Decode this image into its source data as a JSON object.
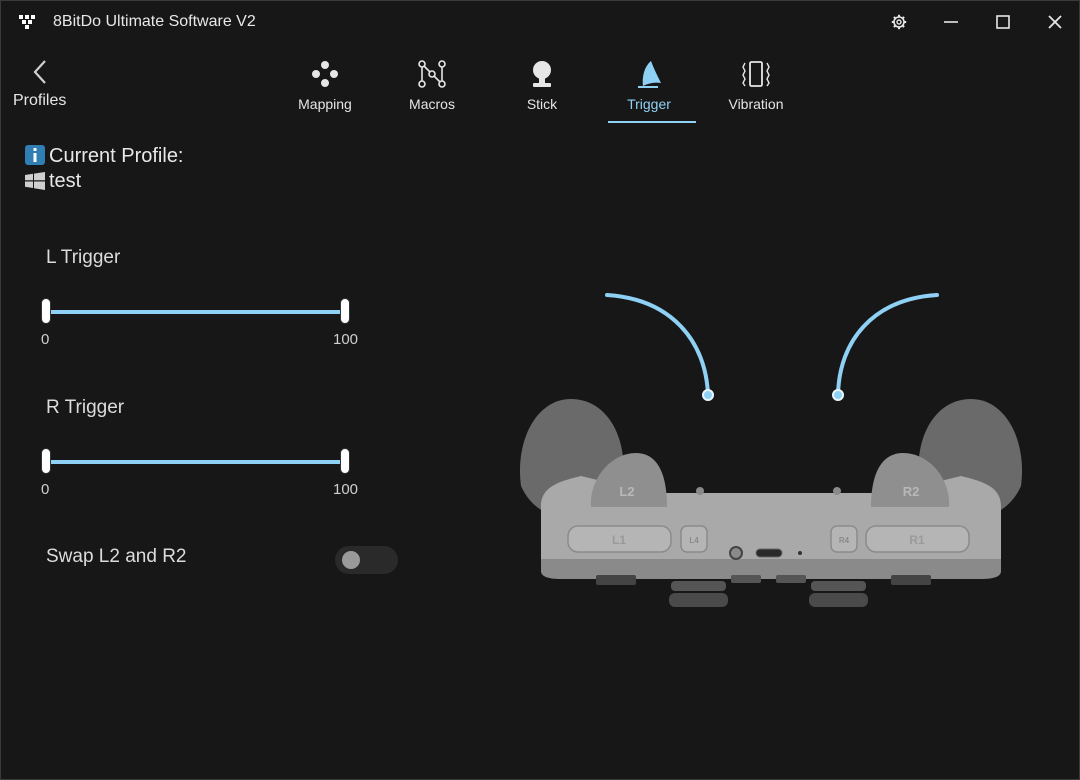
{
  "window": {
    "title": "8BitDo Ultimate Software V2",
    "icons": [
      "app-logo-icon",
      "gear-icon",
      "minimize-icon",
      "maximize-icon",
      "close-icon"
    ]
  },
  "nav": {
    "back_label": "Profiles",
    "back_icon": "chevron-left-icon",
    "tabs": [
      {
        "label": "Mapping",
        "icon": "dpad-dots-icon"
      },
      {
        "label": "Macros",
        "icon": "macro-nodes-icon"
      },
      {
        "label": "Stick",
        "icon": "joystick-icon"
      },
      {
        "label": "Trigger",
        "icon": "trigger-icon",
        "active": true
      },
      {
        "label": "Vibration",
        "icon": "vibration-icon"
      }
    ]
  },
  "profile": {
    "heading": "Current Profile:",
    "name": "test",
    "badge_icon": "profile-info-icon",
    "platform_icon": "windows-icon"
  },
  "triggers": {
    "l": {
      "label": "L Trigger",
      "min_label": "0",
      "max_label": "100",
      "range": [
        0,
        100
      ]
    },
    "r": {
      "label": "R Trigger",
      "min_label": "0",
      "max_label": "100",
      "range": [
        0,
        100
      ]
    }
  },
  "swap": {
    "label": "Swap L2 and R2",
    "enabled": false
  },
  "controller": {
    "button_labels": [
      "L2",
      "R2",
      "L1",
      "R1",
      "L4",
      "R4"
    ],
    "accent": "#8fd1f5"
  },
  "colors": {
    "background": "#171717",
    "accent": "#8fd1f5",
    "text": "#e6e6e6"
  }
}
